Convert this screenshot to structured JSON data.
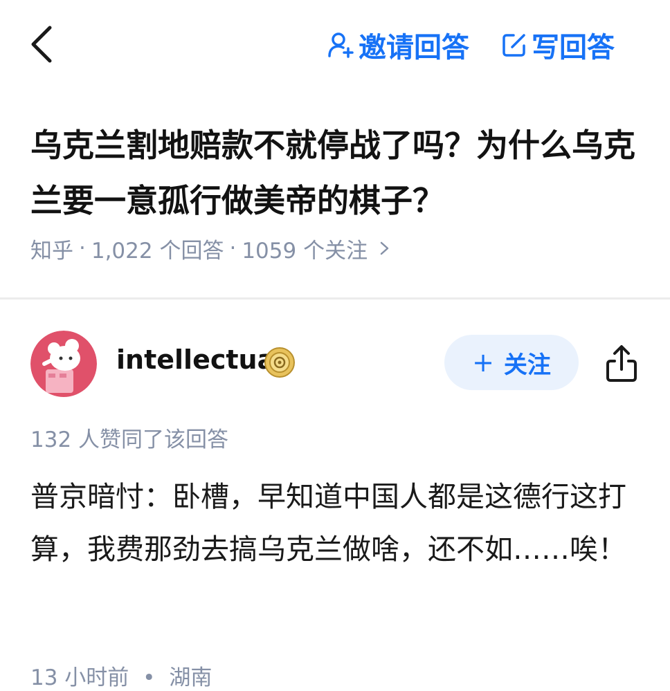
{
  "header": {
    "back_icon": "chevron-left-icon",
    "invite_icon": "person-add-icon",
    "invite_label": "邀请回答",
    "write_icon": "edit-icon",
    "write_label": "写回答",
    "accent_color": "#1772f6"
  },
  "question": {
    "title": "乌克兰割地赔款不就停战了吗？为什么乌克兰要一意孤行做美帝的棋子？",
    "source": "知乎",
    "answers_count": "1,022 个回答",
    "followers_count": "1059 个关注",
    "separator": "·"
  },
  "answer": {
    "author": {
      "name": "intellectual",
      "badge_icon": "gold-badge-icon"
    },
    "follow_label": "关注",
    "share_icon": "share-icon",
    "votes_text": "132 人赞同了该回答",
    "content": "普京暗忖：卧槽，早知道中国人都是这德行这打算，我费那劲去搞乌克兰做啥，还不如……唉！",
    "time": "13 小时前",
    "location": "湖南",
    "separator": "•"
  }
}
